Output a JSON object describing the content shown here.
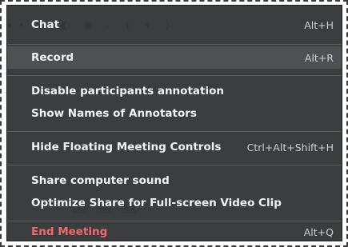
{
  "background": {
    "toolbar_glyphs": "•• ↶ ◐ ◉  ⌕  ⟨ ✦ ⟩"
  },
  "menu": {
    "items": [
      {
        "label": "Chat",
        "shortcut": "Alt+H"
      },
      {
        "label": "Record",
        "shortcut": "Alt+R",
        "highlighted": true
      },
      {
        "label": "Disable participants annotation",
        "shortcut": ""
      },
      {
        "label": "Show Names of Annotators",
        "shortcut": ""
      },
      {
        "label": "Hide Floating Meeting Controls",
        "shortcut": "Ctrl+Alt+Shift+H"
      },
      {
        "label": "Share computer sound",
        "shortcut": ""
      },
      {
        "label": "Optimize Share for Full-screen Video Clip",
        "shortcut": ""
      },
      {
        "label": "End Meeting",
        "shortcut": "Alt+Q",
        "color": "#ef6a6a"
      }
    ]
  },
  "colors": {
    "menu_bg": "#2c2e30",
    "highlight_bg": "#4e5054",
    "separator": "#5b5d60",
    "danger_text": "#ef6a6a"
  }
}
